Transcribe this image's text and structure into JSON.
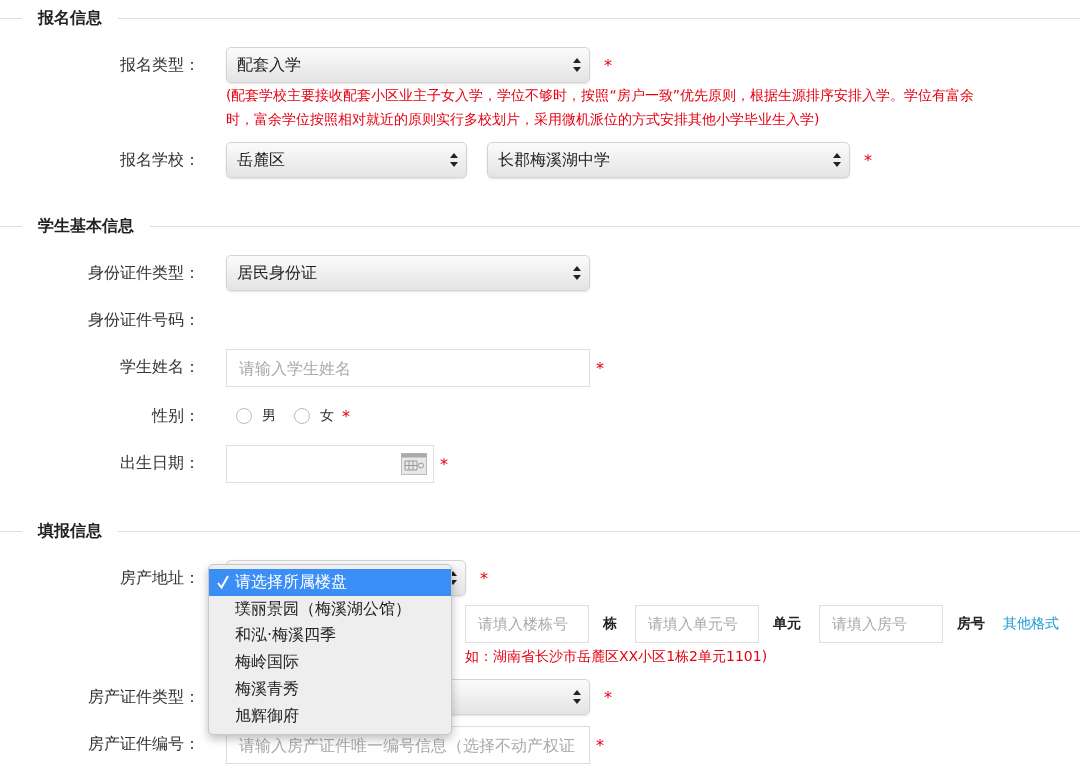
{
  "sections": [
    {
      "title": "报名信息",
      "rows": [
        {
          "kind": "select",
          "label": "报名类型：",
          "selects": [
            {
              "value": "配套入学"
            }
          ],
          "mark": "*",
          "note": "(配套学校主要接收配套小区业主子女入学，学位不够时，按照“房户一致”优先原则，根据生源排序安排入学。学位有富余时，富余学位按照相对就近的原则实行多校划片，采用微机派位的方式安排其他小学毕业生入学)"
        },
        {
          "kind": "select",
          "label": "报名学校：",
          "selects": [
            {
              "value": "岳麓区"
            },
            {
              "value": "长郡梅溪湖中学"
            }
          ],
          "mark": "*"
        }
      ]
    },
    {
      "title": "学生基本信息",
      "rows": [
        {
          "kind": "select",
          "label": "身份证件类型：",
          "selects": [
            {
              "value": "居民身份证"
            }
          ]
        },
        {
          "kind": "text",
          "label": "身份证件号码："
        },
        {
          "kind": "input",
          "label": "学生姓名：",
          "placeholder": "请输入学生姓名",
          "mark": "*"
        },
        {
          "kind": "radio",
          "label": "性别：",
          "options": [
            {
              "label": "男",
              "selected": false
            },
            {
              "label": "女",
              "selected": false
            }
          ],
          "mark": "*"
        },
        {
          "kind": "date",
          "label": "出生日期：",
          "mark": "*"
        }
      ]
    },
    {
      "title": "填报信息",
      "rows": [
        {
          "kind": "address",
          "label": "房产地址：",
          "mark": "*",
          "dropdown": {
            "options": [
              {
                "label": "请选择所属楼盘",
                "selected": true
              },
              {
                "label": "璞丽景园（梅溪湖公馆）",
                "selected": false
              },
              {
                "label": "和泓·梅溪四季",
                "selected": false
              },
              {
                "label": "梅岭国际",
                "selected": false
              },
              {
                "label": "梅溪青秀",
                "selected": false
              },
              {
                "label": "旭辉御府",
                "selected": false
              }
            ]
          },
          "parts": [
            {
              "kind": "input",
              "placeholder": "请填入楼栋号"
            },
            {
              "kind": "unit",
              "text": "栋"
            },
            {
              "kind": "input",
              "placeholder": "请填入单元号"
            },
            {
              "kind": "unit",
              "text": "单元"
            },
            {
              "kind": "input",
              "placeholder": "请填入房号"
            },
            {
              "kind": "unit",
              "text": "房号"
            },
            {
              "kind": "link",
              "text": "其他格式"
            }
          ],
          "hint": "如：湖南省长沙市岳麓区XX小区1栋2单元1101)"
        },
        {
          "kind": "select",
          "label": "房产证件类型：",
          "mark": "*"
        },
        {
          "kind": "input",
          "label": "房产证件编号：",
          "placeholder": "请输入房产证件唯一编号信息（选择不动产权证",
          "mark": "*"
        }
      ]
    }
  ]
}
